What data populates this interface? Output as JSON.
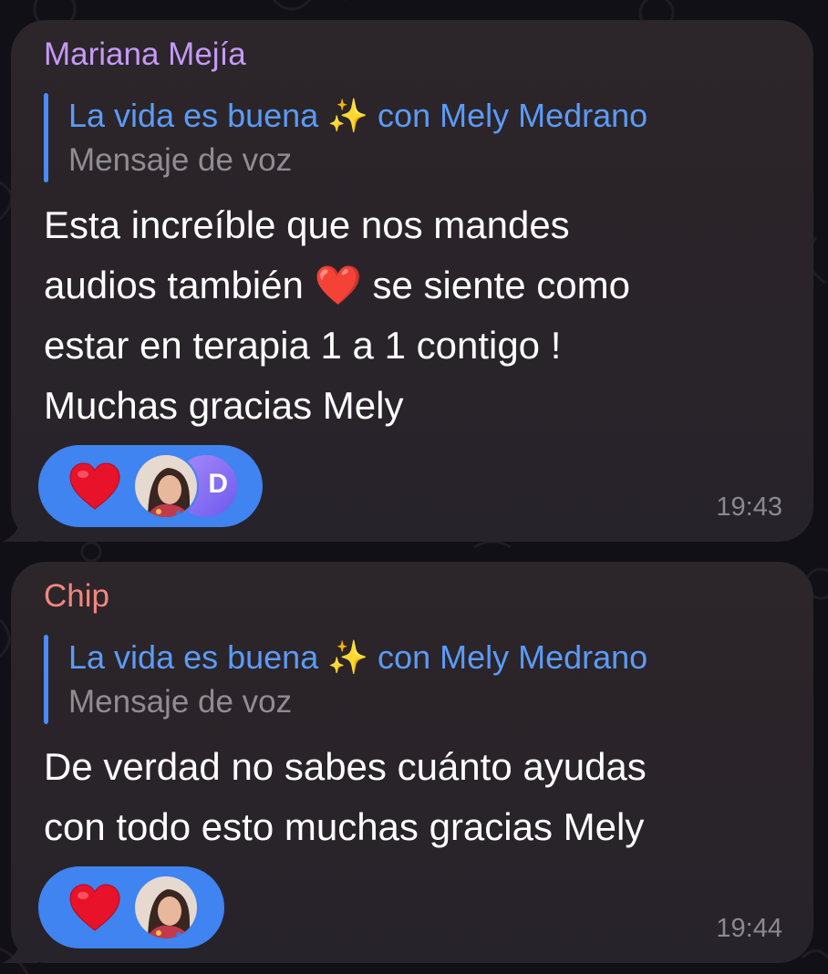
{
  "messages": [
    {
      "sender": "Mariana Mejía",
      "sender_color": "#c49af7",
      "reply": {
        "title": "La vida es buena ✨ con Mely Medrano",
        "subtitle": "Mensaje de voz"
      },
      "text_lines": [
        "Esta increíble que nos mandes",
        "audios también ❤️ se siente como",
        "estar en terapia 1 a 1 contigo !",
        "Muchas gracias Mely"
      ],
      "reactions": {
        "emoji": "heart-icon",
        "users": [
          "photo-avatar",
          "D"
        ]
      },
      "time": "19:43"
    },
    {
      "sender": "Chip",
      "sender_color": "#f2877f",
      "reply": {
        "title": "La vida es buena ✨ con Mely Medrano",
        "subtitle": "Mensaje de voz"
      },
      "text_lines": [
        "De verdad no sabes cuánto ayudas",
        "con todo esto muchas gracias Mely"
      ],
      "reactions": {
        "emoji": "heart-icon",
        "users": [
          "photo-avatar"
        ]
      },
      "time": "19:44"
    }
  ],
  "colors": {
    "accent": "#3f84f0",
    "reply_title": "#5b9bf8",
    "bubble": "#2a2428",
    "background": "#111016"
  }
}
